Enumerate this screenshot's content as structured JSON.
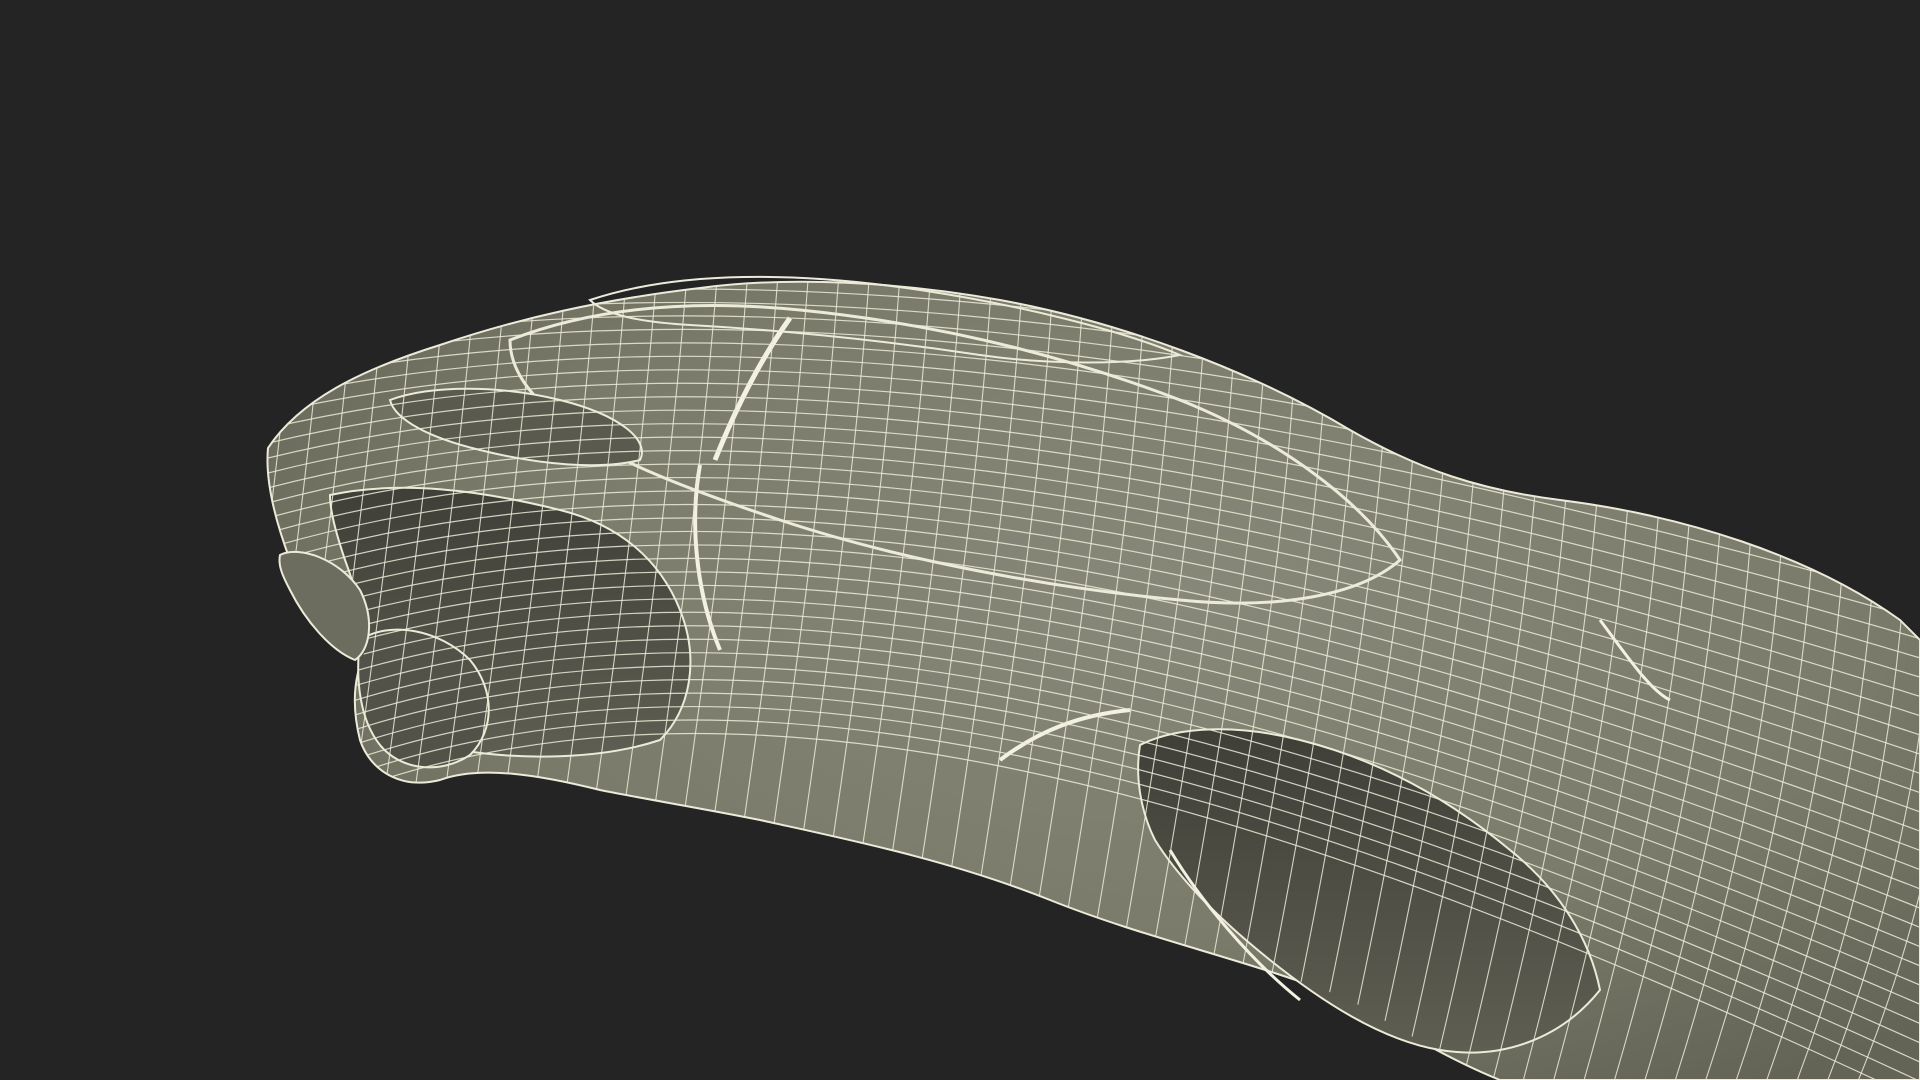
{
  "colors": {
    "background": "#242424",
    "surface": "#7d7d6c",
    "surface_dark": "#646456",
    "cavity": "#4e4e45",
    "wire": "#ecebd9"
  },
  "subject": {
    "icon": "wireframe-car-model-icon"
  }
}
